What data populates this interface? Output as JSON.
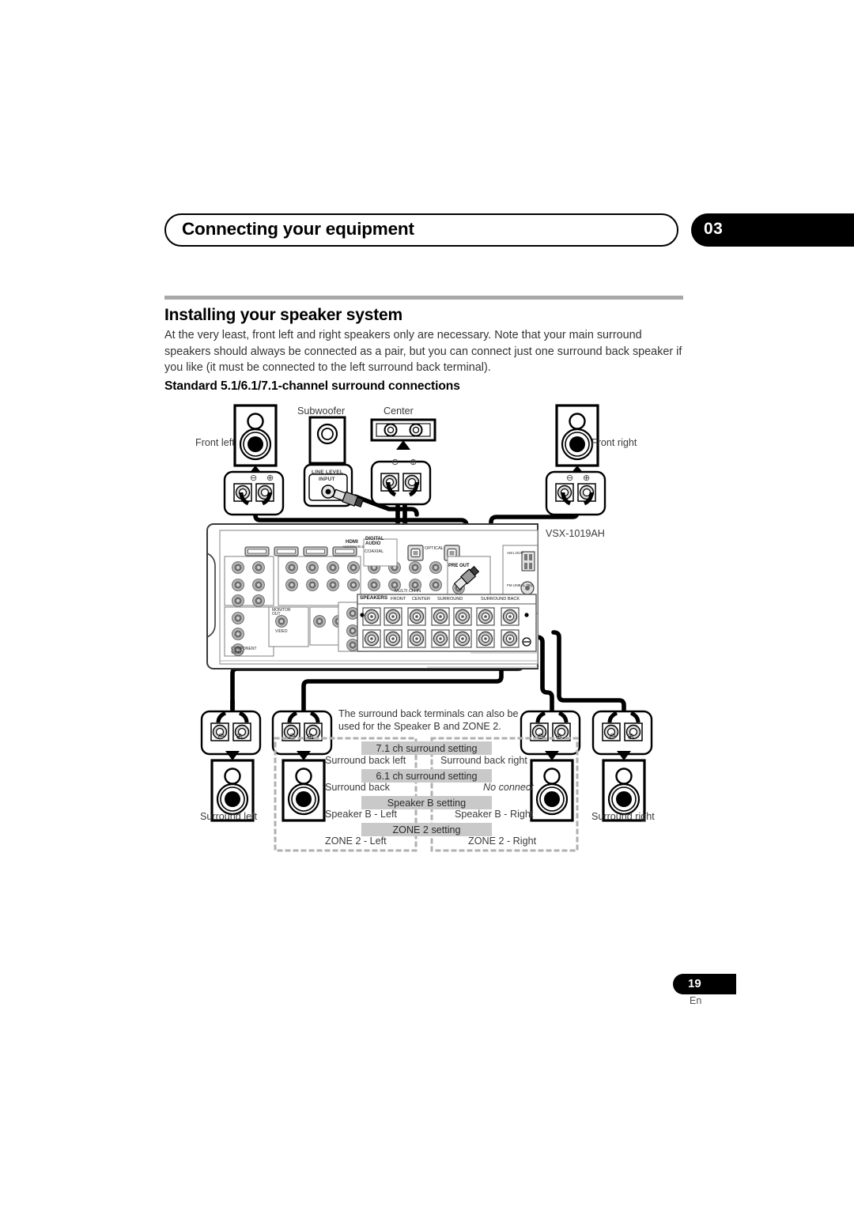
{
  "header": {
    "title": "Connecting your equipment",
    "chapter": "03"
  },
  "section": {
    "title": "Installing your speaker system",
    "body": "At the very least, front left and right speakers only are necessary. Note that your main surround speakers should always be connected as a pair, but you can connect just one surround back speaker if you like (it must be connected to the left surround back terminal).",
    "subtitle": "Standard 5.1/6.1/7.1-channel surround connections"
  },
  "diagram": {
    "model": "VSX-1019AH",
    "speakers": {
      "front_left": "Front left",
      "front_right": "Front right",
      "subwoofer": "Subwoofer",
      "center": "Center",
      "surround_left": "Surround left",
      "surround_right": "Surround right"
    },
    "sub_input": {
      "line1": "LINE LEVEL",
      "line2": "INPUT"
    },
    "note": {
      "line1": "The surround back terminals can also be",
      "line2": "used for the Speaker B and ZONE 2."
    },
    "settings": [
      {
        "band": "7.1 ch surround setting",
        "left": "Surround back left",
        "right": "Surround back right",
        "right_italic": false
      },
      {
        "band": "6.1 ch surround setting",
        "left": "Surround back",
        "right": "No connect",
        "right_italic": true
      },
      {
        "band": "Speaker B setting",
        "left": "Speaker B - Left",
        "right": "Speaker B - Right",
        "right_italic": false
      },
      {
        "band": "ZONE 2 setting",
        "left": "ZONE 2 - Left",
        "right": "ZONE 2 - Right",
        "right_italic": false
      }
    ],
    "rear_panel": {
      "hdmi": "HDMI",
      "hdmi_assign": "ASSIGNABLE",
      "digital_audio": "DIGITAL AUDIO",
      "coaxial": "COAXIAL",
      "optical": "OPTICAL",
      "component_video": "COMPONENT VIDEO",
      "monitor_out": "MONITOR OUT",
      "video": "VIDEO",
      "multi_ch_in": "MULTI CH IN",
      "pre_out": "PRE OUT",
      "speakers": "SPEAKERS",
      "front": "FRONT",
      "center": "CENTER",
      "surround": "SURROUND",
      "surround_back": "SURROUND BACK",
      "am_loop": "AM LOOP",
      "fm_unbal": "FM UNBAL 75Ω"
    },
    "polarity": {
      "minus": "⊖",
      "plus": "⊕"
    }
  },
  "footer": {
    "page": "19",
    "lang": "En"
  }
}
